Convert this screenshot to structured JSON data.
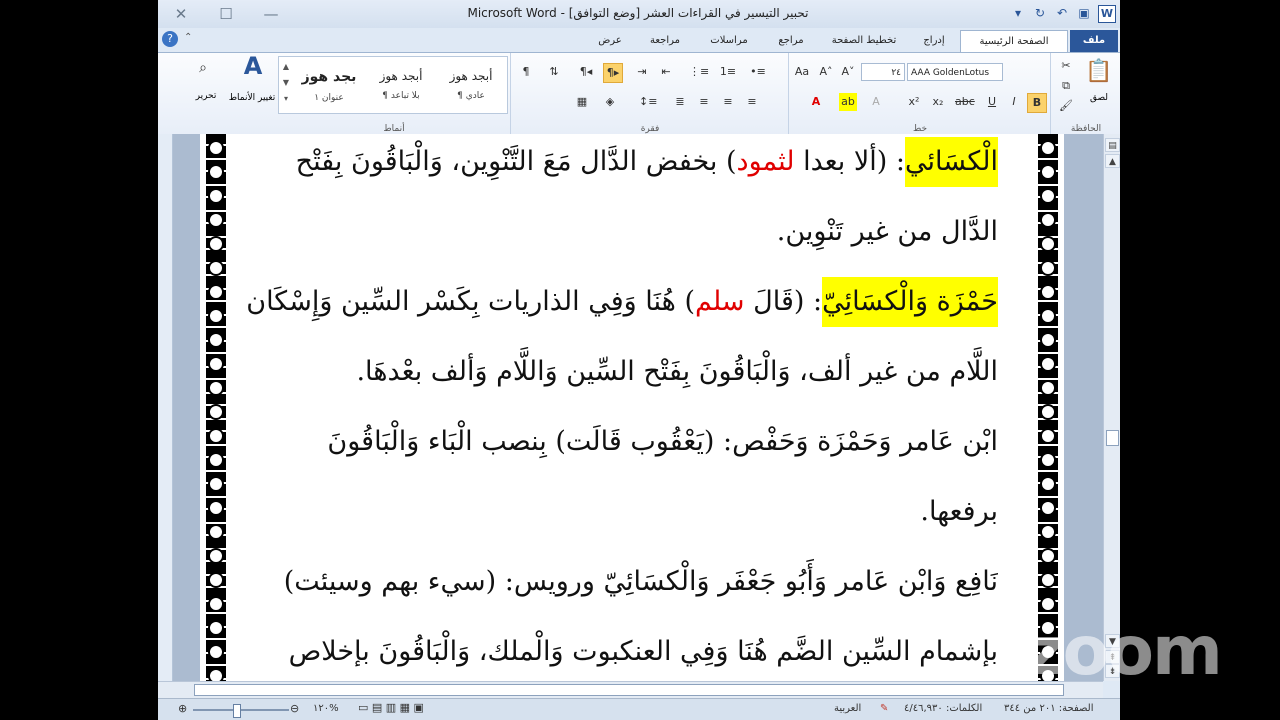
{
  "window": {
    "title": "تحبير التيسير في القراءات العشر [وضع التوافق] - Microsoft Word",
    "controls": {
      "close": "✕",
      "restore": "☐",
      "minimize": "—"
    }
  },
  "tabs": [
    {
      "label": "ملف"
    },
    {
      "label": "الصفحة الرئيسية"
    },
    {
      "label": "إدراج"
    },
    {
      "label": "تخطيط الصفحة"
    },
    {
      "label": "مراجع"
    },
    {
      "label": "مراسلات"
    },
    {
      "label": "مراجعة"
    },
    {
      "label": "عرض"
    }
  ],
  "ribbon": {
    "clipboard": {
      "label": "الحافظة",
      "paste": "لصق"
    },
    "font": {
      "label": "خط",
      "font_name": "AAA GoldenLotus",
      "font_size": "٢٤"
    },
    "paragraph": {
      "label": "فقرة"
    },
    "styles": {
      "label": "أنماط",
      "items": [
        {
          "sample": "أبجد هوز",
          "name": "¶ عادي"
        },
        {
          "sample": "أبجد هوز",
          "name": "¶ بلا تباعد"
        },
        {
          "sample": "بجد هوز",
          "name": "عنوان ١"
        }
      ],
      "change": "تغيير الأنماط"
    },
    "editing": {
      "label": "تحرير"
    }
  },
  "document": {
    "lines": [
      {
        "segments": [
          {
            "text": "الْكسَائي",
            "style": "hl"
          },
          {
            "text": ": (ألا بعدا "
          },
          {
            "text": "لثمود",
            "style": "red"
          },
          {
            "text": ") بخفض الدَّال مَعَ التَّنْوِين، وَالْبَاقُونَ بِفَتْح"
          }
        ]
      },
      {
        "segments": [
          {
            "text": "الدَّال من غير تَنْوِين."
          }
        ]
      },
      {
        "segments": [
          {
            "text": "حَمْزَة وَالْكسَائِيّ",
            "style": "hl"
          },
          {
            "text": ": (قَالَ "
          },
          {
            "text": "سلم",
            "style": "red"
          },
          {
            "text": ") هُنَا وَفِي الذاريات بِكَسْر السِّين وَإِسْكَان"
          }
        ]
      },
      {
        "segments": [
          {
            "text": "اللَّام من غير ألف، وَالْبَاقُونَ بِفَتْح السِّين وَاللَّام وَألف بعْدهَا."
          }
        ]
      },
      {
        "segments": [
          {
            "text": "ابْن عَامر وَحَمْزَة وَحَفْص: (يَعْقُوب قَالَت) بِنصب الْبَاء وَالْبَاقُونَ"
          }
        ]
      },
      {
        "segments": [
          {
            "text": "برفعها."
          }
        ]
      },
      {
        "segments": [
          {
            "text": "نَافِع وَابْن عَامر وَأَبُو جَعْفَر وَالْكسَائِيّ ورويس: (سيء بهم وسيئت)"
          }
        ]
      },
      {
        "segments": [
          {
            "text": "بإشمام السِّين الضَّم هُنَا وَفِي العنكبوت وَالْملك، وَالْبَاقُونَ بإخلاص"
          }
        ]
      }
    ]
  },
  "status": {
    "page": "الصفحة: ٢٠١ من ٣٤٤",
    "words": "الكلمات: ٤/٤٦,٩٣٠",
    "language": "العربية",
    "zoom": "١٢٠%",
    "zoom_fraction": 0.45
  },
  "watermark": "zoom",
  "colors": {
    "highlight": "#ffff00",
    "red_text": "#e00000",
    "file_tab": "#2b579a"
  }
}
